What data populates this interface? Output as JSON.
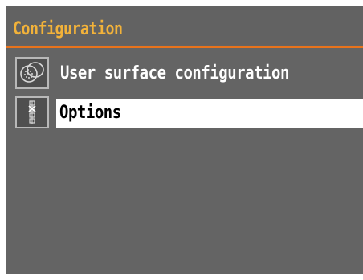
{
  "header": {
    "title": "Configuration",
    "title_color": "#f2b23a",
    "underline_color": "#e8731c"
  },
  "menu": {
    "items": [
      {
        "label": "User surface configuration",
        "icon": "user-surface-icon",
        "selected": false
      },
      {
        "label": "Options",
        "icon": "options-icon",
        "selected": true
      }
    ]
  },
  "colors": {
    "background": "#646464",
    "selection": "#ffffff"
  }
}
